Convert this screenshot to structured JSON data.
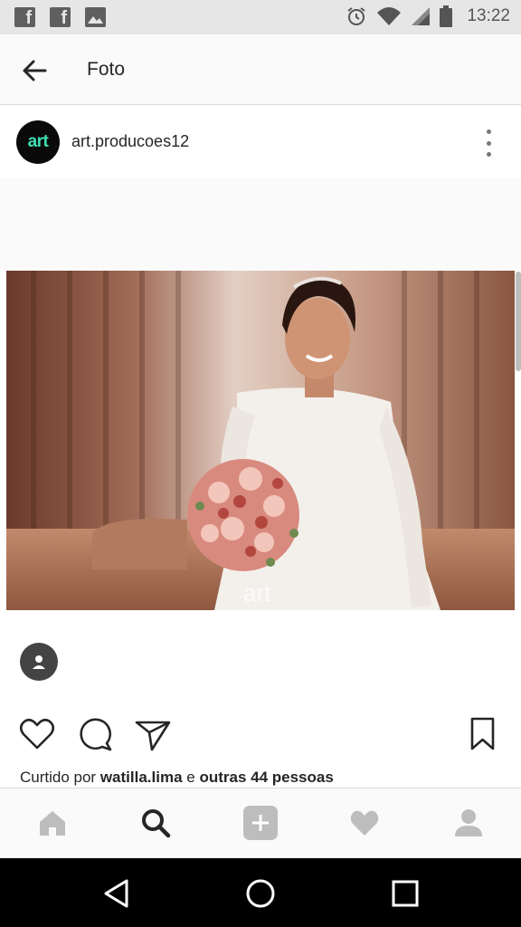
{
  "status_bar": {
    "time": "13:22",
    "icons": [
      "facebook-icon",
      "facebook-icon",
      "image-icon",
      "alarm-icon",
      "wifi-icon",
      "signal-icon",
      "battery-icon"
    ],
    "facebook_glyph": "f"
  },
  "header": {
    "title": "Foto",
    "back_icon": "arrow-back-icon"
  },
  "post": {
    "avatar_text": "art",
    "username": "art.producoes12",
    "more_icon": "more-vertical-icon",
    "photo_watermark": "art",
    "tag_icon": "person-tag-icon"
  },
  "actions": {
    "icons": [
      "heart-icon",
      "comment-icon",
      "send-icon",
      "bookmark-icon"
    ]
  },
  "likes": {
    "prefix": "Curtido por ",
    "user": "watilla.lima",
    "connector": " e ",
    "others": "outras 44 pessoas"
  },
  "bottom_nav": [
    "home-icon",
    "search-icon",
    "add-icon",
    "heart-icon",
    "profile-icon"
  ],
  "system_nav": [
    "back-triangle-icon",
    "home-circle-icon",
    "recents-square-icon"
  ],
  "colors": {
    "avatar_text": "#3ee0b4",
    "icon_active": "#262626",
    "icon_inactive": "#bdbdbd"
  }
}
